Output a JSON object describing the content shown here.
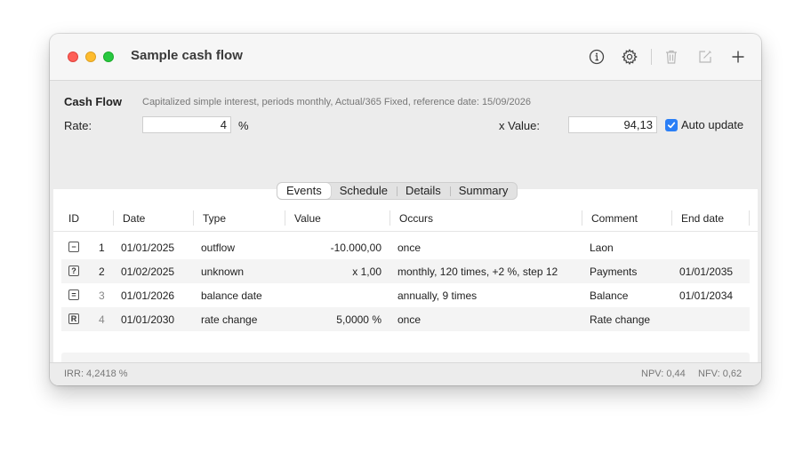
{
  "window": {
    "title": "Sample cash flow",
    "toolbar": {
      "info_icon": "info-circle-icon",
      "settings_icon": "gear-icon",
      "delete_icon": "trash-icon",
      "edit_icon": "compose-icon",
      "add_icon": "plus-icon"
    }
  },
  "cashflow": {
    "section_title": "Cash Flow",
    "description": "Capitalized simple interest, periods monthly, Actual/365 Fixed, reference date: 15/09/2026",
    "rate_label": "Rate:",
    "rate_value": "4",
    "rate_unit": "%",
    "xvalue_label": "x Value:",
    "xvalue_value": "94,13",
    "auto_update_label": "Auto update",
    "auto_update_checked": true
  },
  "tabs": [
    "Events",
    "Schedule",
    "Details",
    "Summary"
  ],
  "active_tab": "Events",
  "table": {
    "columns": [
      "ID",
      "Date",
      "Type",
      "Value",
      "Occurs",
      "Comment",
      "End date"
    ],
    "rows": [
      {
        "icon": "−",
        "icon_name": "minus-box-icon",
        "id": "1",
        "date": "01/01/2025",
        "type": "outflow",
        "value": "-10.000,00",
        "occurs": "once",
        "comment": "Laon",
        "end_date": ""
      },
      {
        "icon": "?",
        "icon_name": "question-box-icon",
        "id": "2",
        "date": "01/02/2025",
        "type": "unknown",
        "value": "x 1,00",
        "occurs": "monthly, 120 times, +2 %, step 12",
        "comment": "Payments",
        "end_date": "01/01/2035"
      },
      {
        "icon": "=",
        "icon_name": "equals-box-icon",
        "id": "3",
        "date": "01/01/2026",
        "type": "balance date",
        "value": "",
        "occurs": "annually, 9 times",
        "comment": "Balance",
        "end_date": "01/01/2034"
      },
      {
        "icon": "R",
        "icon_name": "r-box-icon",
        "id": "4",
        "date": "01/01/2030",
        "type": "rate change",
        "value": "5,0000 %",
        "occurs": "once",
        "comment": "Rate change",
        "end_date": ""
      }
    ]
  },
  "status": {
    "irr": "IRR: 4,2418 %",
    "npv": "NPV:  0,44",
    "nfv": "NFV:  0,62"
  },
  "colors": {
    "accent": "#2b7ff6",
    "close": "#fe5f57",
    "minimize": "#febc2e",
    "zoom": "#28c840"
  }
}
